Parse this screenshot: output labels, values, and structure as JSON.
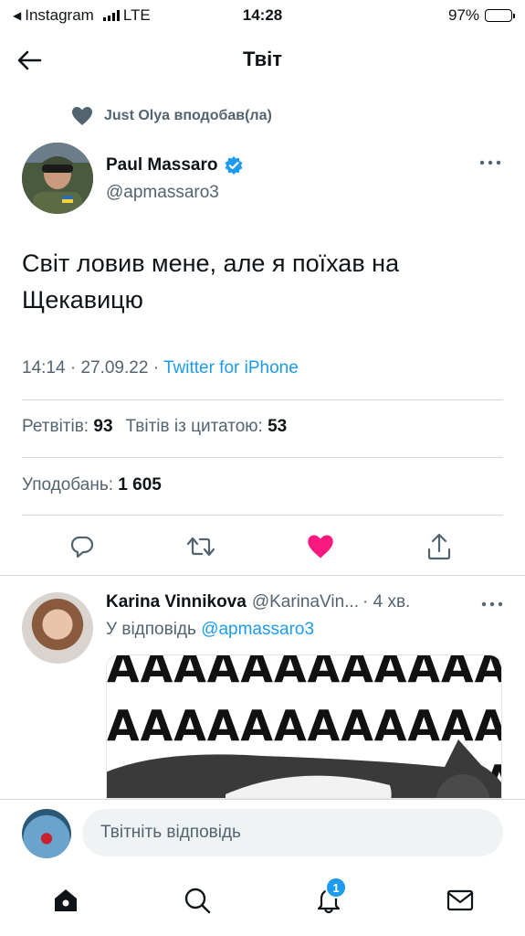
{
  "status_bar": {
    "carrier": "Instagram",
    "network": "LTE",
    "time": "14:28",
    "battery": "97%",
    "battery_level": 0.97
  },
  "header": {
    "title": "Твіт",
    "back_icon": "arrow-left-icon"
  },
  "social_context": {
    "icon": "heart-icon",
    "text": "Just Olya вподобав(ла)"
  },
  "tweet": {
    "author_name": "Paul Massaro",
    "verified": true,
    "author_handle": "@apmassaro3",
    "text": "Світ ловив мене, але я поїхав на Щекавицю",
    "time": "14:14",
    "date": "27.09.22",
    "source": "Twitter for iPhone",
    "retweets_label": "Ретвітів:",
    "retweets": "93",
    "quotes_label": "Твітів із цитатою:",
    "quotes": "53",
    "likes_label": "Уподобань:",
    "likes": "1 605",
    "liked": true
  },
  "actions": {
    "reply_icon": "reply-icon",
    "retweet_icon": "retweet-icon",
    "like_icon": "heart-filled-icon",
    "share_icon": "share-icon"
  },
  "reply": {
    "author_name": "Karina Vinnikova",
    "author_handle": "@KarinaVin...",
    "time": "· 4 хв.",
    "reply_prefix": "У відповідь",
    "reply_to": "@apmassaro3",
    "media_text_row1": "AAAAAAAAAAAAA",
    "media_text_row2": "AAAAAAAAAAAAA",
    "media_text_row3": "A"
  },
  "composer": {
    "placeholder": "Твітніть відповідь"
  },
  "tabbar": {
    "home_icon": "home-icon",
    "search_icon": "search-icon",
    "notifications_icon": "bell-icon",
    "notifications_badge": "1",
    "messages_icon": "envelope-icon"
  },
  "colors": {
    "accent": "#1d9bf0",
    "like": "#f91880",
    "text": "#0f1419",
    "secondary": "#536471"
  }
}
